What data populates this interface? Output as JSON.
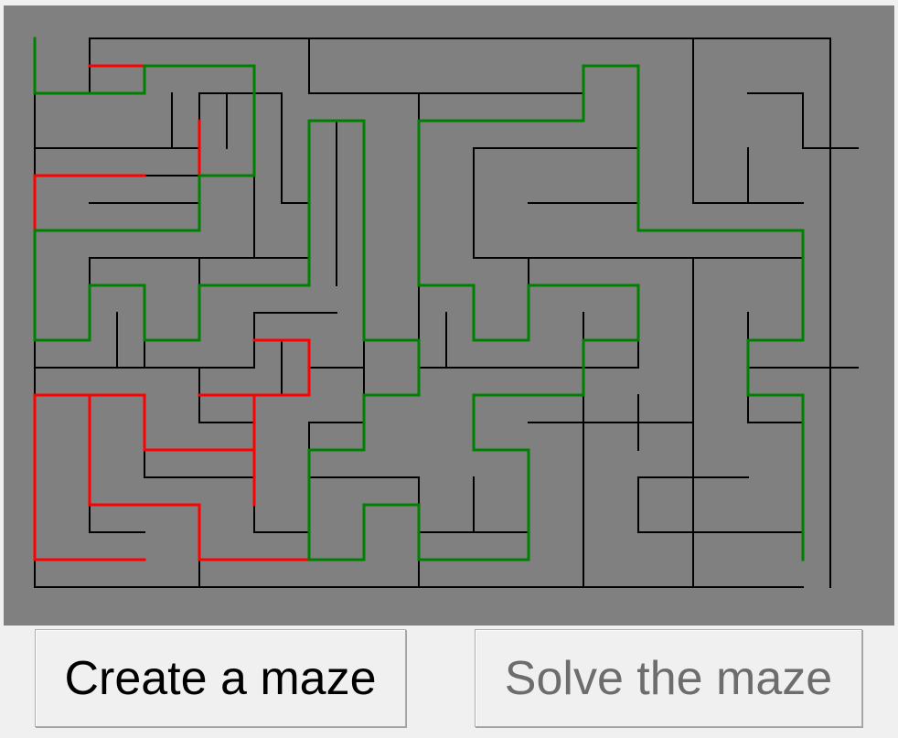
{
  "buttons": {
    "create_label": "Create a maze",
    "solve_label": "Solve the maze",
    "solve_enabled": false
  },
  "maze": {
    "grid_cols": 30,
    "grid_rows": 20,
    "background_color": "#808080",
    "wall_color": "#000000",
    "solution_path_color": "#008000",
    "explored_dead_end_color": "#ff0000",
    "solution_path": [
      [
        1,
        1
      ],
      [
        1,
        3
      ],
      [
        5,
        3
      ],
      [
        5,
        2
      ],
      [
        9,
        2
      ],
      [
        9,
        6
      ],
      [
        7,
        6
      ],
      [
        7,
        8
      ],
      [
        1,
        8
      ],
      [
        1,
        12
      ],
      [
        3,
        12
      ],
      [
        3,
        10
      ],
      [
        5,
        10
      ],
      [
        5,
        12
      ],
      [
        7,
        12
      ],
      [
        7,
        10
      ],
      [
        11,
        10
      ],
      [
        11,
        4
      ],
      [
        13,
        4
      ],
      [
        13,
        12
      ],
      [
        15,
        12
      ],
      [
        15,
        14
      ],
      [
        13,
        14
      ],
      [
        13,
        16
      ],
      [
        11,
        16
      ],
      [
        11,
        20
      ],
      [
        13,
        20
      ],
      [
        13,
        18
      ],
      [
        15,
        18
      ],
      [
        15,
        20
      ],
      [
        19,
        20
      ],
      [
        19,
        16
      ],
      [
        17,
        16
      ],
      [
        17,
        14
      ],
      [
        21,
        14
      ],
      [
        21,
        12
      ],
      [
        23,
        12
      ],
      [
        23,
        10
      ],
      [
        19,
        10
      ],
      [
        19,
        12
      ],
      [
        17,
        12
      ],
      [
        17,
        10
      ],
      [
        15,
        10
      ],
      [
        15,
        4
      ],
      [
        21,
        4
      ],
      [
        21,
        2
      ],
      [
        23,
        2
      ],
      [
        23,
        8
      ],
      [
        29,
        8
      ],
      [
        29,
        12
      ],
      [
        27,
        12
      ],
      [
        27,
        14
      ],
      [
        29,
        14
      ],
      [
        29,
        20
      ]
    ],
    "dead_ends": [
      [
        [
          3,
          2
        ],
        [
          5,
          2
        ]
      ],
      [
        [
          7,
          4
        ],
        [
          7,
          6
        ]
      ],
      [
        [
          5,
          6
        ],
        [
          1,
          6
        ],
        [
          1,
          8
        ]
      ],
      [
        [
          9,
          12
        ],
        [
          11,
          12
        ],
        [
          11,
          14
        ],
        [
          7,
          14
        ]
      ],
      [
        [
          9,
          14
        ],
        [
          9,
          18
        ]
      ],
      [
        [
          9,
          16
        ],
        [
          5,
          16
        ],
        [
          5,
          14
        ],
        [
          1,
          14
        ],
        [
          1,
          20
        ],
        [
          5,
          20
        ]
      ],
      [
        [
          3,
          14
        ],
        [
          3,
          18
        ],
        [
          7,
          18
        ],
        [
          7,
          20
        ],
        [
          11,
          20
        ]
      ]
    ],
    "walls": [
      [
        [
          1,
          1
        ],
        [
          1,
          21
        ]
      ],
      [
        [
          1,
          21
        ],
        [
          29,
          21
        ]
      ],
      [
        [
          30,
          1
        ],
        [
          30,
          21
        ]
      ],
      [
        [
          3,
          1
        ],
        [
          30,
          1
        ]
      ],
      [
        [
          3,
          1
        ],
        [
          3,
          3
        ],
        [
          5,
          3
        ]
      ],
      [
        [
          3,
          5
        ],
        [
          7,
          5
        ]
      ],
      [
        [
          7,
          3
        ],
        [
          7,
          5
        ]
      ],
      [
        [
          7,
          3
        ],
        [
          10,
          3
        ]
      ],
      [
        [
          11,
          1
        ],
        [
          11,
          3
        ],
        [
          21,
          3
        ]
      ],
      [
        [
          10,
          3
        ],
        [
          10,
          7
        ],
        [
          11,
          7
        ]
      ],
      [
        [
          1,
          5
        ],
        [
          3,
          5
        ]
      ],
      [
        [
          3,
          7
        ],
        [
          7,
          7
        ],
        [
          7,
          5
        ]
      ],
      [
        [
          6,
          3
        ],
        [
          6,
          5
        ]
      ],
      [
        [
          8,
          3
        ],
        [
          8,
          5
        ]
      ],
      [
        [
          4,
          6
        ],
        [
          7,
          6
        ]
      ],
      [
        [
          9,
          5
        ],
        [
          9,
          9
        ],
        [
          11,
          9
        ]
      ],
      [
        [
          12,
          4
        ],
        [
          12,
          10
        ]
      ],
      [
        [
          13,
          5
        ],
        [
          13,
          13
        ]
      ],
      [
        [
          15,
          3
        ],
        [
          15,
          13
        ],
        [
          17,
          13
        ]
      ],
      [
        [
          17,
          5
        ],
        [
          23,
          5
        ]
      ],
      [
        [
          17,
          5
        ],
        [
          17,
          9
        ],
        [
          25,
          9
        ]
      ],
      [
        [
          23,
          6
        ],
        [
          23,
          7
        ]
      ],
      [
        [
          19,
          7
        ],
        [
          23,
          7
        ]
      ],
      [
        [
          25,
          1
        ],
        [
          25,
          7
        ],
        [
          29,
          7
        ]
      ],
      [
        [
          27,
          3
        ],
        [
          29,
          3
        ],
        [
          29,
          5
        ],
        [
          31,
          5
        ]
      ],
      [
        [
          27,
          5
        ],
        [
          27,
          7
        ]
      ],
      [
        [
          3,
          9
        ],
        [
          3,
          11
        ]
      ],
      [
        [
          3,
          9
        ],
        [
          11,
          9
        ]
      ],
      [
        [
          5,
          11
        ],
        [
          5,
          12
        ]
      ],
      [
        [
          7,
          9
        ],
        [
          7,
          11
        ]
      ],
      [
        [
          9,
          11
        ],
        [
          12,
          11
        ]
      ],
      [
        [
          9,
          11
        ],
        [
          9,
          13
        ],
        [
          7,
          13
        ],
        [
          7,
          15
        ],
        [
          9,
          15
        ]
      ],
      [
        [
          5,
          11
        ],
        [
          5,
          13
        ],
        [
          1,
          13
        ]
      ],
      [
        [
          1,
          13
        ],
        [
          7,
          13
        ]
      ],
      [
        [
          4,
          11
        ],
        [
          4,
          13
        ]
      ],
      [
        [
          10,
          12
        ],
        [
          10,
          14
        ]
      ],
      [
        [
          11,
          13
        ],
        [
          13,
          13
        ],
        [
          13,
          15
        ],
        [
          11,
          15
        ]
      ],
      [
        [
          16,
          11
        ],
        [
          16,
          13
        ],
        [
          17,
          13
        ]
      ],
      [
        [
          19,
          9
        ],
        [
          19,
          11
        ]
      ],
      [
        [
          17,
          13
        ],
        [
          23,
          13
        ],
        [
          23,
          11
        ]
      ],
      [
        [
          21,
          11
        ],
        [
          21,
          13
        ]
      ],
      [
        [
          25,
          9
        ],
        [
          29,
          9
        ],
        [
          29,
          11
        ]
      ],
      [
        [
          27,
          11
        ],
        [
          27,
          13
        ],
        [
          31,
          13
        ]
      ],
      [
        [
          25,
          9
        ],
        [
          25,
          21
        ]
      ],
      [
        [
          27,
          13
        ],
        [
          27,
          15
        ],
        [
          29,
          15
        ],
        [
          29,
          19
        ]
      ],
      [
        [
          21,
          13
        ],
        [
          21,
          21
        ]
      ],
      [
        [
          23,
          14
        ],
        [
          23,
          16
        ]
      ],
      [
        [
          19,
          15
        ],
        [
          25,
          15
        ]
      ],
      [
        [
          3,
          15
        ],
        [
          3,
          19
        ],
        [
          5,
          19
        ]
      ],
      [
        [
          5,
          15
        ],
        [
          5,
          17
        ],
        [
          9,
          17
        ]
      ],
      [
        [
          7,
          16
        ],
        [
          9,
          16
        ]
      ],
      [
        [
          9,
          17
        ],
        [
          9,
          19
        ],
        [
          11,
          19
        ]
      ],
      [
        [
          11,
          15
        ],
        [
          11,
          17
        ],
        [
          15,
          17
        ],
        [
          15,
          19
        ],
        [
          17,
          19
        ]
      ],
      [
        [
          13,
          18
        ],
        [
          13,
          20
        ]
      ],
      [
        [
          15,
          21
        ],
        [
          15,
          19
        ]
      ],
      [
        [
          17,
          17
        ],
        [
          17,
          19
        ],
        [
          19,
          19
        ],
        [
          19,
          17
        ]
      ],
      [
        [
          7,
          19
        ],
        [
          7,
          21
        ]
      ],
      [
        [
          23,
          17
        ],
        [
          23,
          19
        ],
        [
          29,
          19
        ]
      ],
      [
        [
          23,
          17
        ],
        [
          27,
          17
        ]
      ],
      [
        [
          21,
          21
        ],
        [
          29,
          21
        ]
      ]
    ]
  }
}
